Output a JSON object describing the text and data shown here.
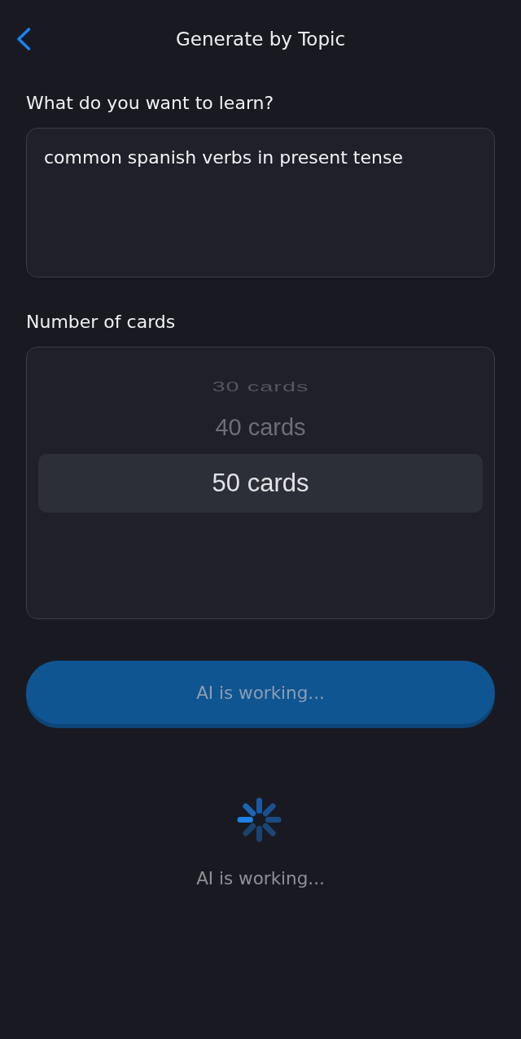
{
  "header": {
    "title": "Generate by Topic"
  },
  "topic": {
    "label": "What do you want to learn?",
    "value": "common spanish verbs in present tense"
  },
  "card_count": {
    "label": "Number of cards",
    "options": [
      {
        "label": "30 cards",
        "selected": false
      },
      {
        "label": "40 cards",
        "selected": false
      },
      {
        "label": "50 cards",
        "selected": true
      }
    ]
  },
  "submit_button": {
    "label": "AI is working...",
    "disabled": true
  },
  "status": {
    "text": "AI is working..."
  }
}
